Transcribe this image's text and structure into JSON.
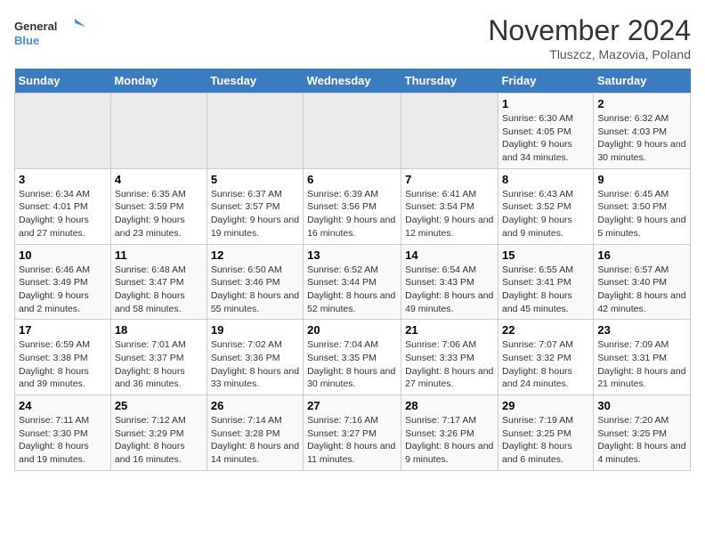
{
  "logo": {
    "line1": "General",
    "line2": "Blue"
  },
  "title": "November 2024",
  "location": "Tluszcz, Mazovia, Poland",
  "days_of_week": [
    "Sunday",
    "Monday",
    "Tuesday",
    "Wednesday",
    "Thursday",
    "Friday",
    "Saturday"
  ],
  "weeks": [
    [
      {
        "day": "",
        "info": ""
      },
      {
        "day": "",
        "info": ""
      },
      {
        "day": "",
        "info": ""
      },
      {
        "day": "",
        "info": ""
      },
      {
        "day": "",
        "info": ""
      },
      {
        "day": "1",
        "info": "Sunrise: 6:30 AM\nSunset: 4:05 PM\nDaylight: 9 hours and 34 minutes."
      },
      {
        "day": "2",
        "info": "Sunrise: 6:32 AM\nSunset: 4:03 PM\nDaylight: 9 hours and 30 minutes."
      }
    ],
    [
      {
        "day": "3",
        "info": "Sunrise: 6:34 AM\nSunset: 4:01 PM\nDaylight: 9 hours and 27 minutes."
      },
      {
        "day": "4",
        "info": "Sunrise: 6:35 AM\nSunset: 3:59 PM\nDaylight: 9 hours and 23 minutes."
      },
      {
        "day": "5",
        "info": "Sunrise: 6:37 AM\nSunset: 3:57 PM\nDaylight: 9 hours and 19 minutes."
      },
      {
        "day": "6",
        "info": "Sunrise: 6:39 AM\nSunset: 3:56 PM\nDaylight: 9 hours and 16 minutes."
      },
      {
        "day": "7",
        "info": "Sunrise: 6:41 AM\nSunset: 3:54 PM\nDaylight: 9 hours and 12 minutes."
      },
      {
        "day": "8",
        "info": "Sunrise: 6:43 AM\nSunset: 3:52 PM\nDaylight: 9 hours and 9 minutes."
      },
      {
        "day": "9",
        "info": "Sunrise: 6:45 AM\nSunset: 3:50 PM\nDaylight: 9 hours and 5 minutes."
      }
    ],
    [
      {
        "day": "10",
        "info": "Sunrise: 6:46 AM\nSunset: 3:49 PM\nDaylight: 9 hours and 2 minutes."
      },
      {
        "day": "11",
        "info": "Sunrise: 6:48 AM\nSunset: 3:47 PM\nDaylight: 8 hours and 58 minutes."
      },
      {
        "day": "12",
        "info": "Sunrise: 6:50 AM\nSunset: 3:46 PM\nDaylight: 8 hours and 55 minutes."
      },
      {
        "day": "13",
        "info": "Sunrise: 6:52 AM\nSunset: 3:44 PM\nDaylight: 8 hours and 52 minutes."
      },
      {
        "day": "14",
        "info": "Sunrise: 6:54 AM\nSunset: 3:43 PM\nDaylight: 8 hours and 49 minutes."
      },
      {
        "day": "15",
        "info": "Sunrise: 6:55 AM\nSunset: 3:41 PM\nDaylight: 8 hours and 45 minutes."
      },
      {
        "day": "16",
        "info": "Sunrise: 6:57 AM\nSunset: 3:40 PM\nDaylight: 8 hours and 42 minutes."
      }
    ],
    [
      {
        "day": "17",
        "info": "Sunrise: 6:59 AM\nSunset: 3:38 PM\nDaylight: 8 hours and 39 minutes."
      },
      {
        "day": "18",
        "info": "Sunrise: 7:01 AM\nSunset: 3:37 PM\nDaylight: 8 hours and 36 minutes."
      },
      {
        "day": "19",
        "info": "Sunrise: 7:02 AM\nSunset: 3:36 PM\nDaylight: 8 hours and 33 minutes."
      },
      {
        "day": "20",
        "info": "Sunrise: 7:04 AM\nSunset: 3:35 PM\nDaylight: 8 hours and 30 minutes."
      },
      {
        "day": "21",
        "info": "Sunrise: 7:06 AM\nSunset: 3:33 PM\nDaylight: 8 hours and 27 minutes."
      },
      {
        "day": "22",
        "info": "Sunrise: 7:07 AM\nSunset: 3:32 PM\nDaylight: 8 hours and 24 minutes."
      },
      {
        "day": "23",
        "info": "Sunrise: 7:09 AM\nSunset: 3:31 PM\nDaylight: 8 hours and 21 minutes."
      }
    ],
    [
      {
        "day": "24",
        "info": "Sunrise: 7:11 AM\nSunset: 3:30 PM\nDaylight: 8 hours and 19 minutes."
      },
      {
        "day": "25",
        "info": "Sunrise: 7:12 AM\nSunset: 3:29 PM\nDaylight: 8 hours and 16 minutes."
      },
      {
        "day": "26",
        "info": "Sunrise: 7:14 AM\nSunset: 3:28 PM\nDaylight: 8 hours and 14 minutes."
      },
      {
        "day": "27",
        "info": "Sunrise: 7:16 AM\nSunset: 3:27 PM\nDaylight: 8 hours and 11 minutes."
      },
      {
        "day": "28",
        "info": "Sunrise: 7:17 AM\nSunset: 3:26 PM\nDaylight: 8 hours and 9 minutes."
      },
      {
        "day": "29",
        "info": "Sunrise: 7:19 AM\nSunset: 3:25 PM\nDaylight: 8 hours and 6 minutes."
      },
      {
        "day": "30",
        "info": "Sunrise: 7:20 AM\nSunset: 3:25 PM\nDaylight: 8 hours and 4 minutes."
      }
    ]
  ]
}
